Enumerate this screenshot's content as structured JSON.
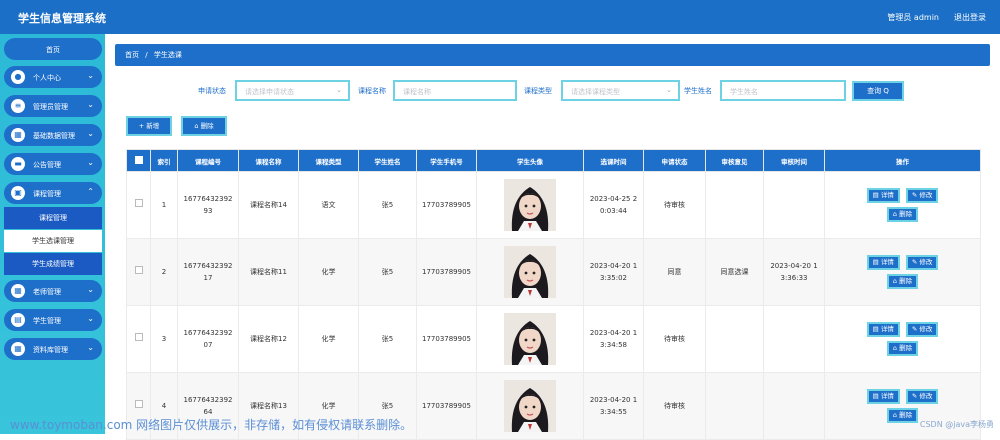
{
  "header": {
    "title": "学生信息管理系统",
    "admin": "管理员 admin",
    "logout": "退出登录"
  },
  "sidebar": {
    "home": "首页",
    "items": [
      {
        "label": "个人中心",
        "icon": "user-icon"
      },
      {
        "label": "管理员管理",
        "icon": "list-icon"
      },
      {
        "label": "基础数据管理",
        "icon": "grid-icon"
      },
      {
        "label": "公告管理",
        "icon": "bell-icon"
      },
      {
        "label": "课程管理",
        "icon": "briefcase-icon"
      },
      {
        "label": "老师管理",
        "icon": "grid-icon"
      },
      {
        "label": "学生管理",
        "icon": "doc-icon"
      },
      {
        "label": "资料库管理",
        "icon": "grid-icon"
      }
    ],
    "sub": [
      "课程管理",
      "学生选课管理",
      "学生成绩管理"
    ]
  },
  "breadcrumb": {
    "home": "首页",
    "sep": "/",
    "current": "学生选课"
  },
  "filters": [
    {
      "label": "申请状态",
      "placeholder": "请选择申请状态"
    },
    {
      "label": "课程名称",
      "placeholder": "课程名称"
    },
    {
      "label": "课程类型",
      "placeholder": "请选择课程类型"
    },
    {
      "label": "学生姓名",
      "placeholder": "学生姓名"
    }
  ],
  "buttons": {
    "query": "查询 Q",
    "add": "+ 新增",
    "delete": "删除"
  },
  "table": {
    "headers": [
      "",
      "索引",
      "课程编号",
      "课程名称",
      "课程类型",
      "学生姓名",
      "学生手机号",
      "学生头像",
      "选课时间",
      "申请状态",
      "审核意见",
      "审核时间",
      "操作"
    ],
    "rows": [
      {
        "index": "1",
        "code": "16776432392 93",
        "name": "课程名称14",
        "type": "语文",
        "student": "张5",
        "phone": "17703789905",
        "time": "2023-04-25 2 0:03:44",
        "status": "待审核",
        "opinion": "",
        "audit_time": ""
      },
      {
        "index": "2",
        "code": "16776432392 17",
        "name": "课程名称11",
        "type": "化学",
        "student": "张5",
        "phone": "17703789905",
        "time": "2023-04-20 1 3:35:02",
        "status": "同意",
        "opinion": "同意选课",
        "audit_time": "2023-04-20 1 3:36:33"
      },
      {
        "index": "3",
        "code": "16776432392 07",
        "name": "课程名称12",
        "type": "化学",
        "student": "张5",
        "phone": "17703789905",
        "time": "2023-04-20 1 3:34:58",
        "status": "待审核",
        "opinion": "",
        "audit_time": ""
      },
      {
        "index": "4",
        "code": "16776432392 64",
        "name": "课程名称13",
        "type": "化学",
        "student": "张5",
        "phone": "17703789905",
        "time": "2023-04-20 1 3:34:55",
        "status": "待审核",
        "opinion": "",
        "audit_time": ""
      }
    ],
    "actions": {
      "detail": "详情",
      "edit": "修改",
      "delete": "删除"
    }
  },
  "watermark": "www.toymoban.com 网络图片仅供展示，非存储，如有侵权请联系删除。",
  "credit": "CSDN @java李杨勇",
  "colors": {
    "primary": "#1e6fca",
    "sidebar": "#2bb9d7",
    "border_accent": "#6dd3e4"
  }
}
